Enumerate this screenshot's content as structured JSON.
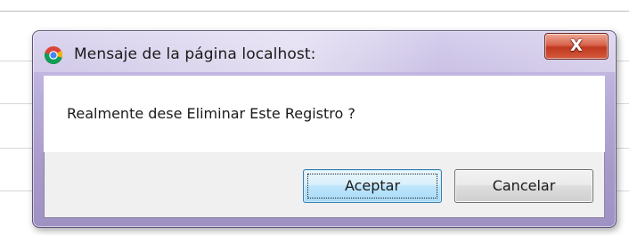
{
  "dialog": {
    "title": "Mensaje de la página localhost:",
    "app_icon": "chrome-icon",
    "close_icon": "close-icon",
    "close_glyph": "X",
    "message": "Realmente dese Eliminar Este Registro ?",
    "buttons": {
      "accept_label": "Aceptar",
      "cancel_label": "Cancelar"
    }
  },
  "colors": {
    "frame": "#b8acd9",
    "close_button": "#c1391f",
    "default_button_border": "#3c7fb1"
  }
}
